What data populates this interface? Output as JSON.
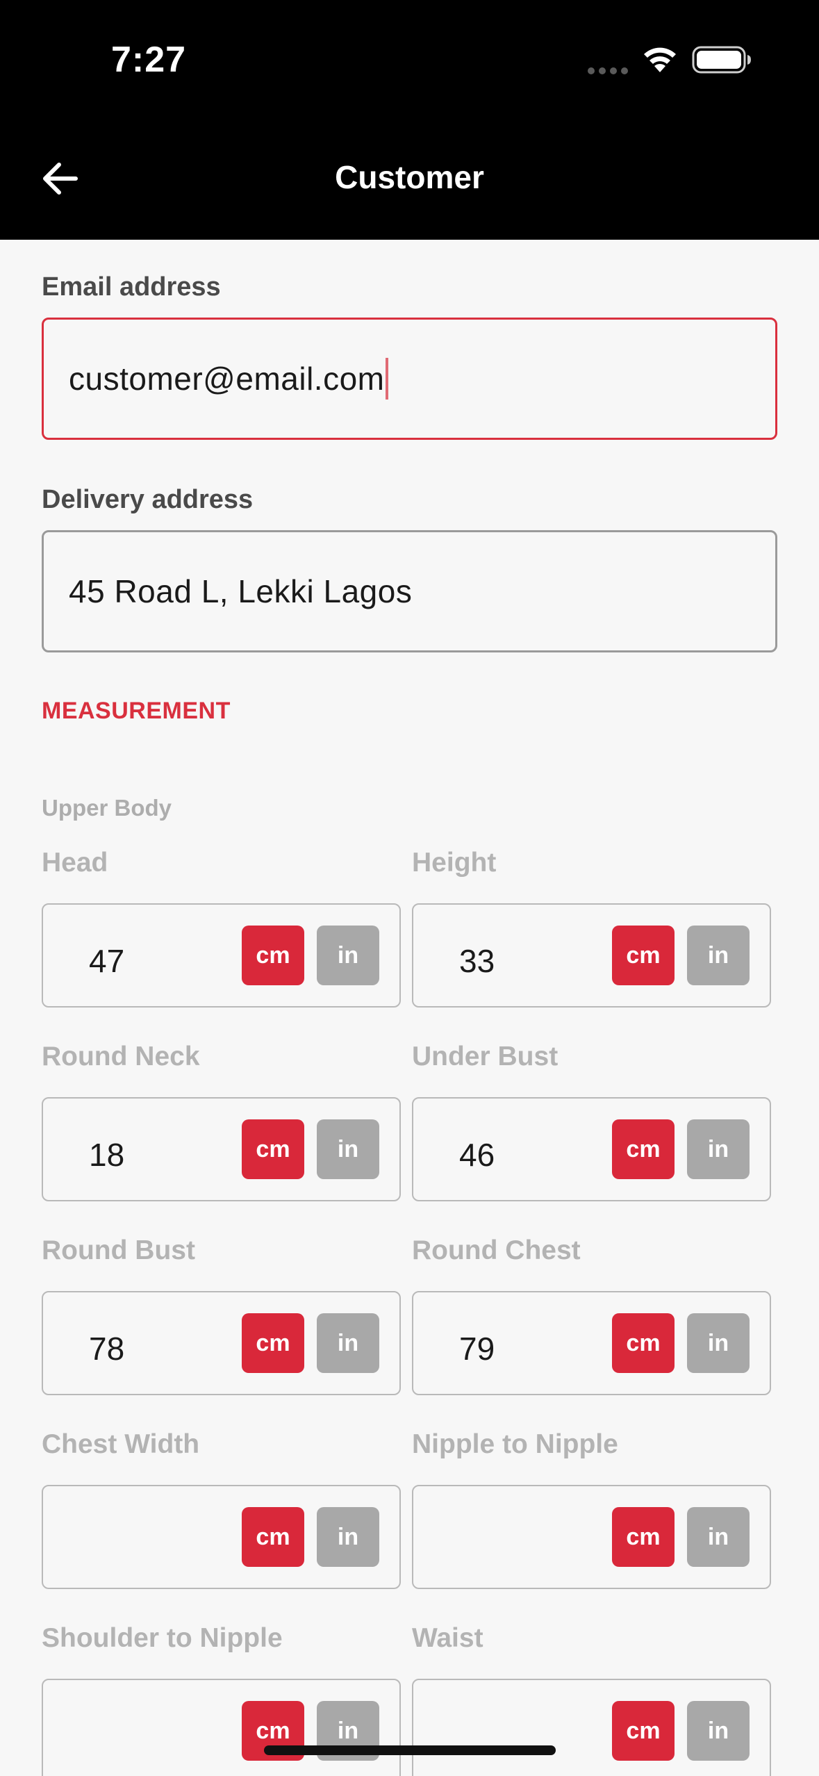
{
  "status_bar": {
    "time": "7:27"
  },
  "header": {
    "title": "Customer"
  },
  "email": {
    "label": "Email address",
    "value": "customer@email.com"
  },
  "delivery": {
    "label": "Delivery address",
    "value": "45 Road L, Lekki Lagos"
  },
  "measurement": {
    "section_title": "MEASUREMENT",
    "group_title": "Upper Body",
    "unit_cm": "cm",
    "unit_in": "in",
    "selected_unit": "cm",
    "fields": [
      {
        "label": "Head",
        "value": "47"
      },
      {
        "label": "Height",
        "value": "33"
      },
      {
        "label": "Round Neck",
        "value": "18"
      },
      {
        "label": "Under Bust",
        "value": "46"
      },
      {
        "label": "Round Bust",
        "value": "78"
      },
      {
        "label": "Round Chest",
        "value": "79"
      },
      {
        "label": "Chest Width",
        "value": ""
      },
      {
        "label": "Nipple to Nipple",
        "value": ""
      },
      {
        "label": "Shoulder to Nipple",
        "value": ""
      },
      {
        "label": "Waist",
        "value": ""
      }
    ]
  },
  "colors": {
    "accent": "#d9303e",
    "unit_active": "#d9283a",
    "unit_inactive": "#a8a8a8",
    "header_bg": "#000000"
  }
}
